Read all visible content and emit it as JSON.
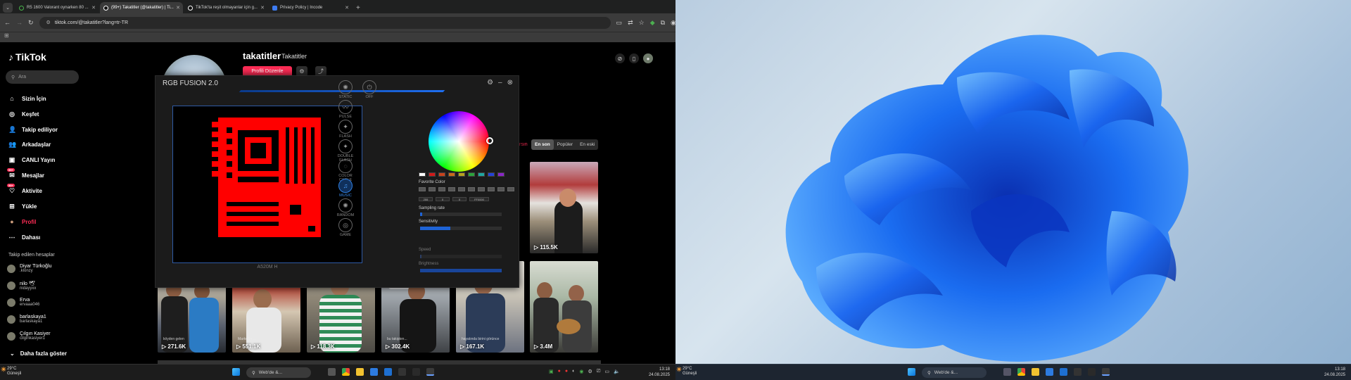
{
  "browser": {
    "tabs": [
      {
        "title": "R5 1600 Valorant oynarken 80 ...",
        "active": false,
        "color": "#49b34a"
      },
      {
        "title": "(99+) Takatitler (@takatitler) | Ti...",
        "active": true,
        "color": "#ffffff"
      },
      {
        "title": "TikTok'ta reşit olmayanlar için g...",
        "active": false,
        "color": "#ffffff"
      },
      {
        "title": "Privacy Policy | Incode",
        "active": false,
        "color": "#3d7bf0"
      }
    ],
    "url": "tiktok.com/@takatitler?lang=tr-TR"
  },
  "tiktok": {
    "logo": "TikTok",
    "search_placeholder": "Ara",
    "nav": [
      {
        "label": "Sizin İçin",
        "icon": "home-icon",
        "glyph": "⌂",
        "red": false
      },
      {
        "label": "Keşfet",
        "icon": "compass-icon",
        "glyph": "◎",
        "red": false
      },
      {
        "label": "Takip ediliyor",
        "icon": "user-follow-icon",
        "glyph": "👤",
        "red": false
      },
      {
        "label": "Arkadaşlar",
        "icon": "friends-icon",
        "glyph": "👥",
        "red": false
      },
      {
        "label": "CANLI Yayın",
        "icon": "live-icon",
        "glyph": "▣",
        "red": false
      },
      {
        "label": "Mesajlar",
        "icon": "message-icon",
        "glyph": "✉",
        "red": false,
        "badge": "99+"
      },
      {
        "label": "Aktivite",
        "icon": "activity-icon",
        "glyph": "♡",
        "red": false,
        "badge": "99+"
      },
      {
        "label": "Yükle",
        "icon": "upload-icon",
        "glyph": "⊞",
        "red": false
      },
      {
        "label": "Profil",
        "icon": "avatar-icon",
        "glyph": "●",
        "red": true
      },
      {
        "label": "Dahası",
        "icon": "more-icon",
        "glyph": "⋯",
        "red": false
      }
    ],
    "following_title": "Takip edilen hesaplar",
    "following": [
      {
        "name": "Diyar Türkoğlu",
        "handle": ".klonzy"
      },
      {
        "name": "nilo 🕊",
        "handle": "nidayyxx"
      },
      {
        "name": "Erva",
        "handle": "ervaaa046"
      },
      {
        "name": "barlaskaya1",
        "handle": "barlaskaya1"
      },
      {
        "name": "Çılgın Kasiyer",
        "handle": "cilginkasiyer1"
      }
    ],
    "show_more": "Daha fazla göster",
    "profile": {
      "username": "takatitler",
      "display_name": "Takatitler",
      "edit_button": "Profili Düzenle"
    },
    "sort_tabs": [
      "En son",
      "Popüler",
      "En eski"
    ],
    "sort_partial_label": "rsın",
    "videos": [
      {
        "views": "115.5K",
        "caption": ""
      },
      {
        "views": "271.6K",
        "caption": "köyden gelen"
      },
      {
        "views": "551.1K",
        "caption": "Market'in ..."
      },
      {
        "views": "118.3K",
        "caption": ""
      },
      {
        "views": "302.4K",
        "caption": "bu takipten..."
      },
      {
        "views": "167.1K",
        "caption": "hayatında birini görünce"
      },
      {
        "views": "3.4M",
        "caption": ""
      }
    ]
  },
  "rgb_fusion": {
    "title": "RGB FUSION 2.0",
    "board_name": "A520M H",
    "modes": [
      "STATIC",
      "OFF",
      "PULSE",
      "FLASH",
      "DOUBLE FLASH",
      "COLOR CYCLE",
      "MUSIC",
      "RANDOM",
      "GAME"
    ],
    "active_mode": "MUSIC",
    "favorite_color_label": "Favorite Color",
    "sampling_rate_label": "Sampling rate",
    "sensitivity_label": "Sensitivity",
    "speed_label": "Speed",
    "brightness_label": "Brightness",
    "color_values": [
      "255",
      "0",
      "0",
      "FF0000"
    ],
    "sensitivity_level": 0.37,
    "brightness_level": 1.0,
    "sampling_level": 0.03,
    "speed_level": 0.02,
    "board_color": "#ff0000",
    "swatch_colors": [
      "#ffffff",
      "#d11919",
      "#c8421c",
      "#c96a1b",
      "#b6a21f",
      "#2ba43c",
      "#1fa7a1",
      "#2342d8",
      "#8a25c8"
    ]
  },
  "taskbar": {
    "weather_temp": "29°C",
    "weather_desc": "Güneşli",
    "search_placeholder": "Web'de &...",
    "time": "13:18",
    "date": "24.08.2025"
  }
}
